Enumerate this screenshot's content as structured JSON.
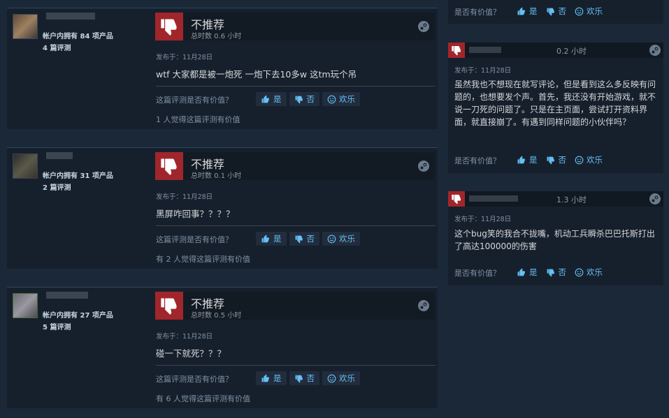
{
  "colors": {
    "accent": "#66c0f4",
    "negative": "#a0262b",
    "bg": "#1b2838",
    "card": "#16202d"
  },
  "reviews_left": [
    {
      "owned": "帐户内拥有 84 项产品",
      "reviews": "4 篇评测",
      "verdict": "不推荐",
      "hours": "总时数 0.6 小时",
      "posted": "发布于：11月28日",
      "content": "wtf 大家都是被一炮死 一炮下去10多w 这tm玩个吊",
      "helpful_question": "这篇评测是否有价值？",
      "yes": "是",
      "no": "否",
      "funny": "欢乐",
      "helpful_count": "1 人觉得这篇评测有价值"
    },
    {
      "owned": "帐户内拥有 31 项产品",
      "reviews": "2 篇评测",
      "verdict": "不推荐",
      "hours": "总时数 0.1 小时",
      "posted": "发布于：11月28日",
      "content": "黑屏咋回事？？？？",
      "helpful_question": "这篇评测是否有价值？",
      "yes": "是",
      "no": "否",
      "funny": "欢乐",
      "helpful_count": "有 2 人觉得这篇评测有价值"
    },
    {
      "owned": "帐户内拥有 27 项产品",
      "reviews": "5 篇评测",
      "verdict": "不推荐",
      "hours": "总时数 0.5 小时",
      "posted": "发布于：11月28日",
      "content": "碰一下就死？？？",
      "helpful_question": "这篇评测是否有价值？",
      "yes": "是",
      "no": "否",
      "funny": "欢乐",
      "helpful_count": "有 6 人觉得这篇评测有价值"
    }
  ],
  "top_right_helpful": {
    "question": "是否有价值？",
    "yes": "是",
    "no": "否",
    "funny": "欢乐"
  },
  "reviews_right": [
    {
      "hours": "0.2 小时",
      "posted": "发布于：11月28日",
      "content": "虽然我也不想现在就写评论，但是看到这么多反映有问题的，也想要发个声。首先，我还没有开始游戏，就不说一刀死的问题了。只是在主页面，尝试打开资料界面，就直接崩了。有遇到同样问题的小伙伴吗？",
      "question": "是否有价值？",
      "yes": "是",
      "no": "否",
      "funny": "欢乐"
    },
    {
      "hours": "1.3 小时",
      "posted": "发布于：11月28日",
      "content": "这个bug笑的我合不拢嘴，机动工兵瞬杀巴巴托斯打出了高达100000的伤害",
      "question": "是否有价值？",
      "yes": "是",
      "no": "否",
      "funny": "欢乐"
    }
  ]
}
